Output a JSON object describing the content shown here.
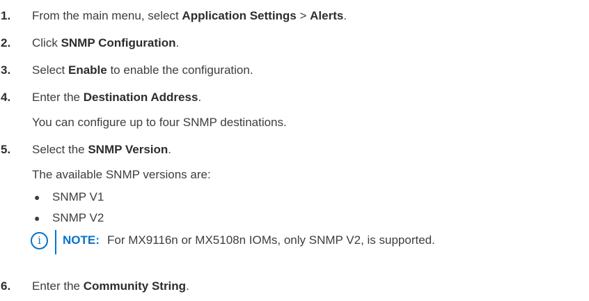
{
  "steps": [
    {
      "num": "1.",
      "pre": "From the main menu, select ",
      "b1": "Application Settings",
      "mid": " > ",
      "b2": "Alerts",
      "post": "."
    },
    {
      "num": "2.",
      "pre": "Click ",
      "b1": "SNMP Configuration",
      "post": "."
    },
    {
      "num": "3.",
      "pre": "Select ",
      "b1": "Enable",
      "post": " to enable the configuration."
    },
    {
      "num": "4.",
      "pre": "Enter the ",
      "b1": "Destination Address",
      "post": ".",
      "sub": "You can configure up to four SNMP destinations."
    },
    {
      "num": "5.",
      "pre": "Select the ",
      "b1": "SNMP Version",
      "post": ".",
      "sub": "The available SNMP versions are:"
    },
    {
      "num": "6.",
      "pre": "Enter the ",
      "b1": "Community String",
      "post": "."
    }
  ],
  "versions": [
    "SNMP V1",
    "SNMP V2"
  ],
  "note": {
    "icon": "info-icon",
    "label": "NOTE:",
    "text": "For MX9116n or MX5108n IOMs, only SNMP V2, is supported."
  },
  "colors": {
    "accent": "#0672cb",
    "text": "#3d3d3d"
  }
}
